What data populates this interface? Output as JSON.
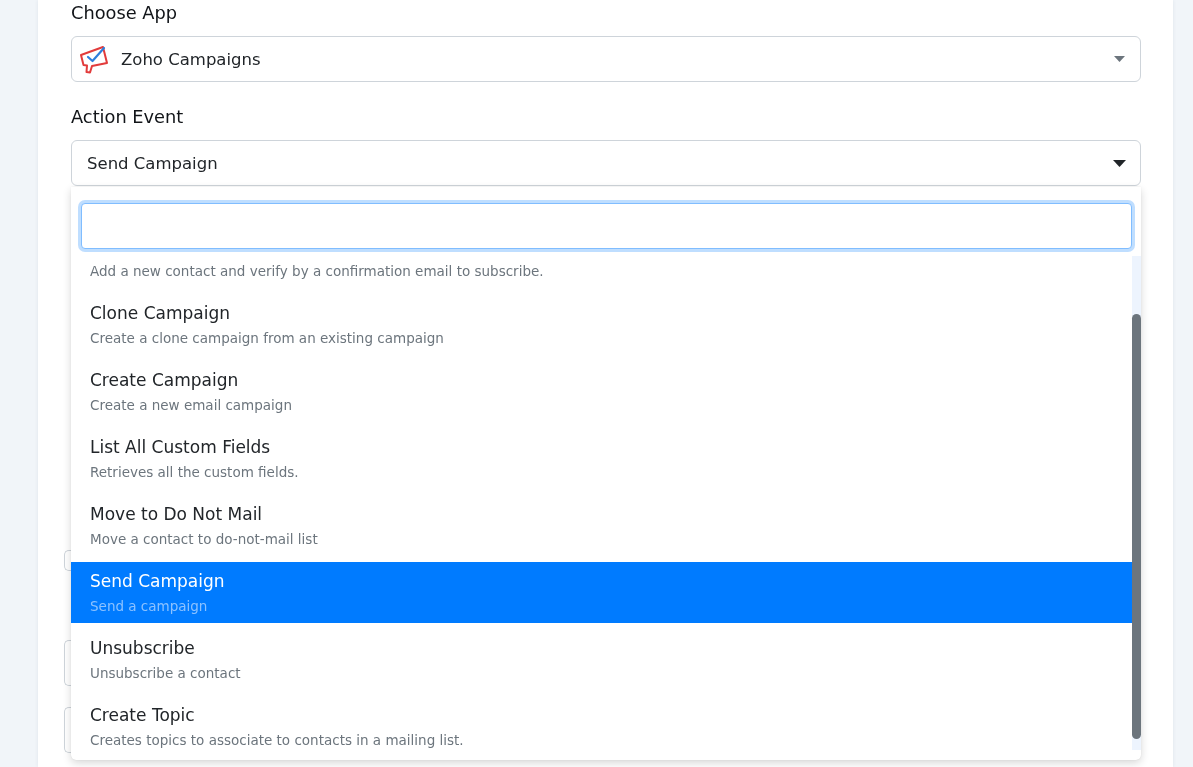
{
  "form": {
    "fields": [
      {
        "kind": "app_select",
        "label": "Choose App",
        "value": "Zoho Campaigns",
        "expanded": false
      },
      {
        "kind": "select",
        "label": "Action Event",
        "value": "Send Campaign",
        "expanded": true,
        "search": {
          "focused": true
        },
        "options": [
          {
            "description": "Add a new contact and verify by a confirmation email to subscribe.",
            "selected": false
          },
          {
            "title": "Clone Campaign",
            "description": "Create a clone campaign from an existing campaign",
            "selected": false
          },
          {
            "title": "Create Campaign",
            "description": "Create a new email campaign",
            "selected": false
          },
          {
            "title": "List All Custom Fields",
            "description": "Retrieves all the custom fields.",
            "selected": false
          },
          {
            "title": "Move to Do Not Mail",
            "description": "Move a contact to do-not-mail list",
            "selected": false
          },
          {
            "title": "Send Campaign",
            "description": "Send a campaign",
            "selected": true
          },
          {
            "title": "Unsubscribe",
            "description": "Unsubscribe a contact",
            "selected": false
          },
          {
            "title": "Create Topic",
            "description": "Creates topics to associate to contacts in a mailing list.",
            "selected": false
          }
        ]
      }
    ],
    "covered_fields": [
      {
        "kind": "small_field"
      },
      {
        "kind": "field"
      },
      {
        "kind": "field"
      }
    ]
  }
}
